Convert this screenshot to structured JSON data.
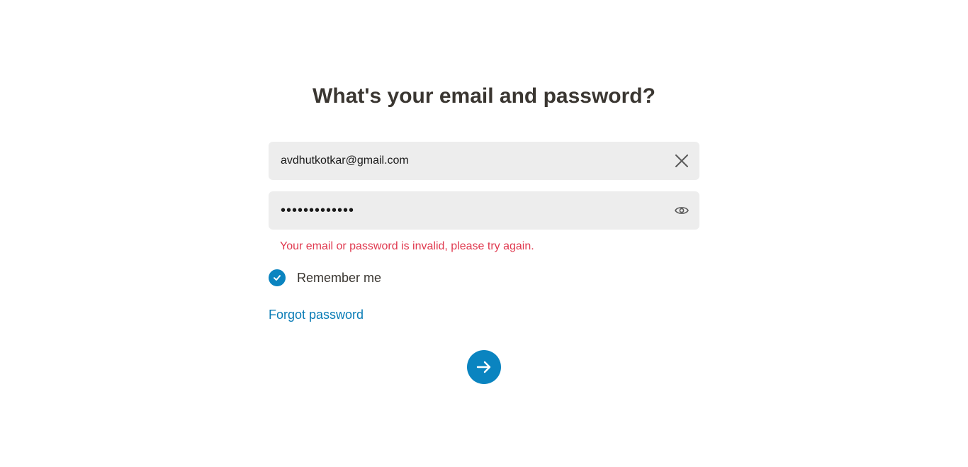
{
  "form": {
    "title": "What's your email and password?",
    "email": {
      "value": "avdhutkotkar@gmail.com",
      "clear_icon": "close-icon"
    },
    "password": {
      "value": "•••••••••••••",
      "toggle_icon": "eye-icon"
    },
    "error_message": "Your email or password is invalid, please try again.",
    "remember_me": {
      "label": "Remember me",
      "checked": true
    },
    "forgot_password_label": "Forgot password",
    "submit_icon": "arrow-right-icon"
  },
  "colors": {
    "accent": "#0a84c0",
    "link": "#0a7cb6",
    "error": "#e0394f",
    "title": "#3a3631",
    "field_bg": "#ededed"
  }
}
